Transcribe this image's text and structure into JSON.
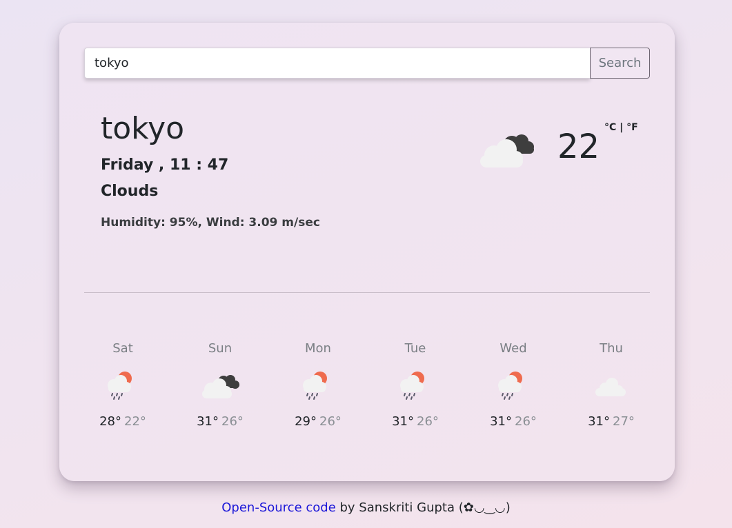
{
  "search": {
    "value": "tokyo",
    "placeholder": "",
    "button_label": "Search"
  },
  "current": {
    "city": "tokyo",
    "datetime": "Friday , 11 : 47",
    "condition": "Clouds",
    "details": "Humidity: 95%, Wind: 3.09 m/sec",
    "temperature": "22",
    "unit_c": "°C",
    "unit_separator": " | ",
    "unit_f": "°F",
    "icon": "broken-clouds-icon"
  },
  "forecast": [
    {
      "day": "Sat",
      "max": "28°",
      "min": "22°",
      "icon": "rain-sun-icon"
    },
    {
      "day": "Sun",
      "max": "31°",
      "min": "26°",
      "icon": "broken-clouds-icon"
    },
    {
      "day": "Mon",
      "max": "29°",
      "min": "26°",
      "icon": "rain-sun-icon"
    },
    {
      "day": "Tue",
      "max": "31°",
      "min": "26°",
      "icon": "rain-sun-icon"
    },
    {
      "day": "Wed",
      "max": "31°",
      "min": "26°",
      "icon": "rain-sun-icon"
    },
    {
      "day": "Thu",
      "max": "31°",
      "min": "27°",
      "icon": "cloud-icon"
    }
  ],
  "footer": {
    "link_text": "Open-Source code",
    "text": " by Sanskriti Gupta (✿◡‿◡)"
  },
  "colors": {
    "cloud_light": "#f2f2f2",
    "cloud_dark": "#3e3e3e",
    "sun": "#ef6b4e",
    "rain": "#5a5a6a",
    "link": "#1b17d8"
  }
}
